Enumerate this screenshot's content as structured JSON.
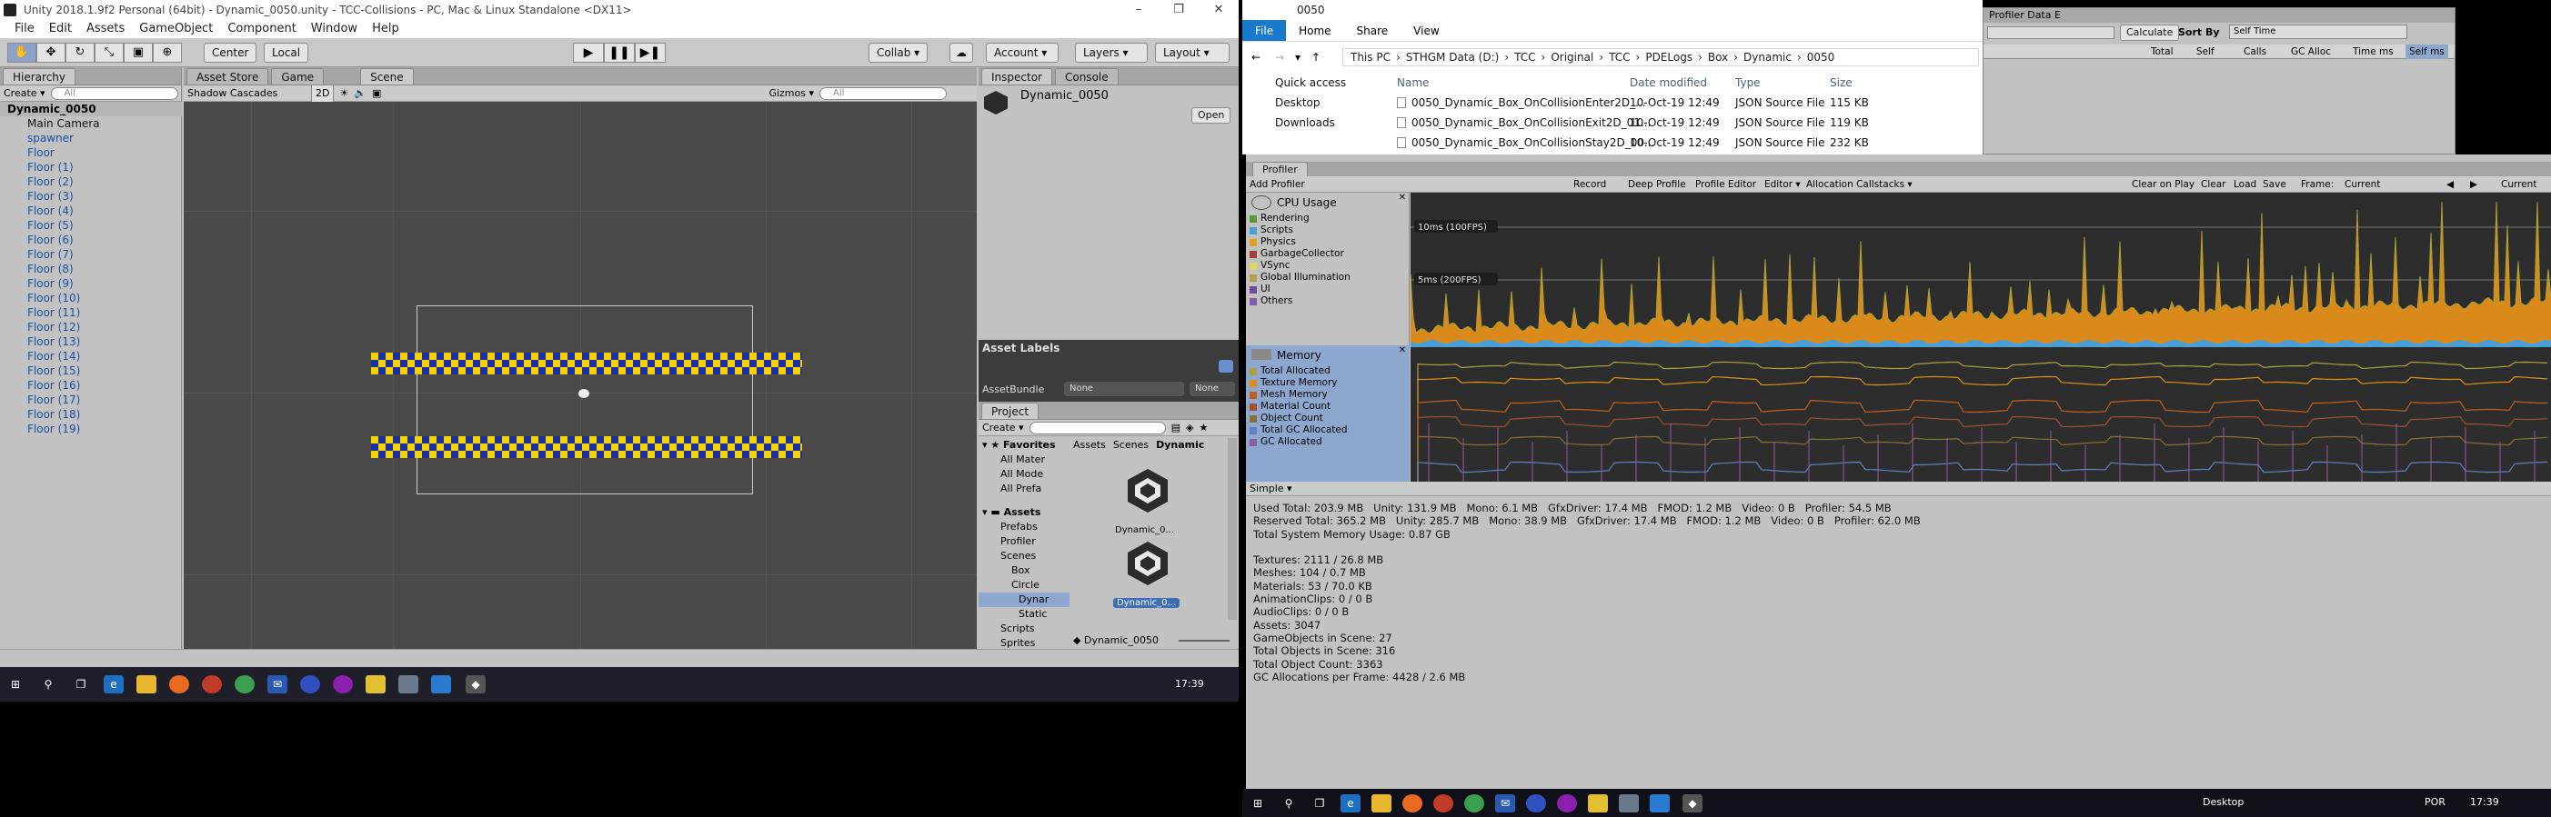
{
  "unity": {
    "title": "Unity 2018.1.9f2 Personal (64bit) - Dynamic_0050.unity - TCC-Collisions - PC, Mac & Linux Standalone <DX11>",
    "menus": [
      "File",
      "Edit",
      "Assets",
      "GameObject",
      "Component",
      "Window",
      "Help"
    ],
    "toolbar": {
      "center": "Center",
      "local": "Local",
      "collab": "Collab ▾",
      "account": "Account ▾",
      "layers": "Layers ▾",
      "layout": "Layout ▾"
    },
    "hierarchy": {
      "tab": "Hierarchy",
      "create": "Create ▾",
      "search_placeholder": "All",
      "root": "Dynamic_0050",
      "items": [
        "Main Camera",
        "spawner",
        "Floor",
        "Floor (1)",
        "Floor (2)",
        "Floor (3)",
        "Floor (4)",
        "Floor (5)",
        "Floor (6)",
        "Floor (7)",
        "Floor (8)",
        "Floor (9)",
        "Floor (10)",
        "Floor (11)",
        "Floor (12)",
        "Floor (13)",
        "Floor (14)",
        "Floor (15)",
        "Floor (16)",
        "Floor (17)",
        "Floor (18)",
        "Floor (19)"
      ]
    },
    "scene": {
      "tabs": [
        "Asset Store",
        "Game",
        "Scene"
      ],
      "shading": "Shadow Cascades",
      "mode": "2D",
      "gizmos": "Gizmos ▾",
      "search_placeholder": "All"
    },
    "inspector": {
      "tabs": [
        "Inspector",
        "Console"
      ],
      "object": "Dynamic_0050",
      "open": "Open",
      "asset_labels": "Asset Labels",
      "asset_bundle": "AssetBundle",
      "none1": "None",
      "none2": "None"
    },
    "project": {
      "tab": "Project",
      "create": "Create ▾",
      "favorites": "Favorites",
      "fav_items": [
        "All Mater",
        "All Mode",
        "All Prefa"
      ],
      "assets": "Assets",
      "tree": [
        "Prefabs",
        "Profiler",
        "Scenes",
        "Box",
        "Circle",
        "Dynar",
        "Static",
        "Scripts",
        "Sprites"
      ],
      "breadcrumb": [
        "Assets",
        "Scenes",
        "Dynamic"
      ],
      "files": [
        "Dynamic_0...",
        "Dynamic_0..."
      ],
      "footer": "Dynamic_0050"
    }
  },
  "taskbar_left": {
    "time": "17:39"
  },
  "explorer": {
    "title": "0050",
    "ribbon": [
      "File",
      "Home",
      "Share",
      "View"
    ],
    "path": [
      "This PC",
      "STHGM Data (D:)",
      "TCC",
      "Original",
      "TCC",
      "PDELogs",
      "Box",
      "Dynamic",
      "0050"
    ],
    "nav": [
      "Quick access",
      "Desktop",
      "Downloads"
    ],
    "columns": [
      "Name",
      "Date modified",
      "Type",
      "Size"
    ],
    "files": [
      {
        "name": "0050_Dynamic_Box_OnCollisionEnter2D_...",
        "date": "10-Oct-19 12:49",
        "type": "JSON Source File",
        "size": "115 KB"
      },
      {
        "name": "0050_Dynamic_Box_OnCollisionExit2D_01...",
        "date": "10-Oct-19 12:49",
        "type": "JSON Source File",
        "size": "119 KB"
      },
      {
        "name": "0050_Dynamic_Box_OnCollisionStay2D_00...",
        "date": "10-Oct-19 12:49",
        "type": "JSON Source File",
        "size": "232 KB"
      }
    ]
  },
  "profiler_data": {
    "title": "Profiler Data E",
    "calculate": "Calculate",
    "sort_by": "Sort By",
    "sort_value": "Self Time",
    "columns": [
      "Total",
      "Self",
      "Calls",
      "GC Alloc",
      "Time ms",
      "Self ms"
    ]
  },
  "profiler": {
    "tab": "Profiler",
    "add": "Add Profiler",
    "toolbar": [
      "Record",
      "Deep Profile",
      "Profile Editor",
      "Editor ▾",
      "Allocation Callstacks ▾"
    ],
    "right_toolbar": [
      "Clear on Play",
      "Clear",
      "Load",
      "Save",
      "Frame:",
      "Current",
      "Current"
    ],
    "cpu_title": "CPU Usage",
    "cpu_legend": [
      {
        "label": "Rendering",
        "color": "#5b9a3a"
      },
      {
        "label": "Scripts",
        "color": "#4aa0d6"
      },
      {
        "label": "Physics",
        "color": "#e0a020"
      },
      {
        "label": "GarbageCollector",
        "color": "#a04040"
      },
      {
        "label": "VSync",
        "color": "#d8d860"
      },
      {
        "label": "Global Illumination",
        "color": "#b0a050"
      },
      {
        "label": "UI",
        "color": "#6a4fa0"
      },
      {
        "label": "Others",
        "color": "#7d5faa"
      }
    ],
    "cpu_lines": [
      "10ms (100FPS)",
      "5ms (200FPS)"
    ],
    "mem_title": "Memory",
    "mem_legend": [
      {
        "label": "Total Allocated",
        "color": "#b0a040"
      },
      {
        "label": "Texture Memory",
        "color": "#d89020"
      },
      {
        "label": "Mesh Memory",
        "color": "#c06020"
      },
      {
        "label": "Material Count",
        "color": "#a05030"
      },
      {
        "label": "Object Count",
        "color": "#8a7030"
      },
      {
        "label": "Total GC Allocated",
        "color": "#6080c0"
      },
      {
        "label": "GC Allocated",
        "color": "#8a60a0"
      }
    ],
    "view_mode": "Simple",
    "stats": [
      "Used Total: 203.9 MB   Unity: 131.9 MB   Mono: 6.1 MB   GfxDriver: 17.4 MB   FMOD: 1.2 MB   Video: 0 B   Profiler: 54.5 MB",
      "Reserved Total: 365.2 MB   Unity: 285.7 MB   Mono: 38.9 MB   GfxDriver: 17.4 MB   FMOD: 1.2 MB   Video: 0 B   Profiler: 62.0 MB",
      "Total System Memory Usage: 0.87 GB",
      "",
      "Textures: 2111 / 26.8 MB",
      "Meshes: 104 / 0.7 MB",
      "Materials: 53 / 70.0 KB",
      "AnimationClips: 0 / 0 B",
      "AudioClips: 0 / 0 B",
      "Assets: 3047",
      "GameObjects in Scene: 27",
      "Total Objects in Scene: 316",
      "Total Object Count: 3363",
      "GC Allocations per Frame: 4428 / 2.6 MB"
    ]
  },
  "taskbar_right": {
    "desktop": "Desktop",
    "lang": "POR",
    "time": "17:39"
  }
}
